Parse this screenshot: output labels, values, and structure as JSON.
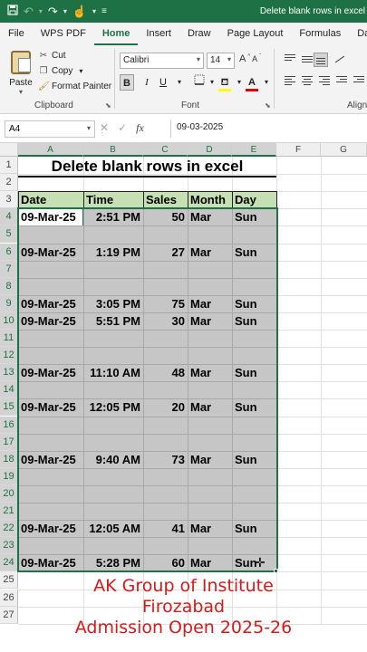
{
  "titlebar": {
    "document_title": "Delete blank rows in excel"
  },
  "ribbon_tabs": [
    "File",
    "WPS PDF",
    "Home",
    "Insert",
    "Draw",
    "Page Layout",
    "Formulas",
    "Da"
  ],
  "active_tab": "Home",
  "clipboard": {
    "paste_label": "Paste",
    "cut_label": "Cut",
    "copy_label": "Copy",
    "format_painter_label": "Format Painter",
    "group_label": "Clipboard"
  },
  "font": {
    "family": "Calibri",
    "size": "14",
    "group_label": "Font",
    "bold_label": "B",
    "italic_label": "I",
    "underline_label": "U",
    "fill_color": "#ffff00",
    "font_color": "#e00000"
  },
  "alignment": {
    "group_label": "Align"
  },
  "formula_bar": {
    "name_box": "A4",
    "formula": "09-03-2025",
    "fx_label": "fx"
  },
  "columns": [
    "A",
    "B",
    "C",
    "D",
    "E",
    "F",
    "G"
  ],
  "sheet": {
    "title": "Delete blank rows in excel",
    "headers": [
      "Date",
      "Time",
      "Sales",
      "Month",
      "Day"
    ],
    "rows": [
      {
        "row": "4",
        "date": "09-Mar-25",
        "time": "2:51 PM",
        "sales": "50",
        "month": "Mar",
        "day": "Sun"
      },
      {
        "row": "5",
        "date": "",
        "time": "",
        "sales": "",
        "month": "",
        "day": ""
      },
      {
        "row": "6",
        "date": "09-Mar-25",
        "time": "1:19 PM",
        "sales": "27",
        "month": "Mar",
        "day": "Sun"
      },
      {
        "row": "7",
        "date": "",
        "time": "",
        "sales": "",
        "month": "",
        "day": ""
      },
      {
        "row": "8",
        "date": "",
        "time": "",
        "sales": "",
        "month": "",
        "day": ""
      },
      {
        "row": "9",
        "date": "09-Mar-25",
        "time": "3:05 PM",
        "sales": "75",
        "month": "Mar",
        "day": "Sun"
      },
      {
        "row": "10",
        "date": "09-Mar-25",
        "time": "5:51 PM",
        "sales": "30",
        "month": "Mar",
        "day": "Sun"
      },
      {
        "row": "11",
        "date": "",
        "time": "",
        "sales": "",
        "month": "",
        "day": ""
      },
      {
        "row": "12",
        "date": "",
        "time": "",
        "sales": "",
        "month": "",
        "day": ""
      },
      {
        "row": "13",
        "date": "09-Mar-25",
        "time": "11:10 AM",
        "sales": "48",
        "month": "Mar",
        "day": "Sun"
      },
      {
        "row": "14",
        "date": "",
        "time": "",
        "sales": "",
        "month": "",
        "day": ""
      },
      {
        "row": "15",
        "date": "09-Mar-25",
        "time": "12:05 PM",
        "sales": "20",
        "month": "Mar",
        "day": "Sun"
      },
      {
        "row": "16",
        "date": "",
        "time": "",
        "sales": "",
        "month": "",
        "day": ""
      },
      {
        "row": "17",
        "date": "",
        "time": "",
        "sales": "",
        "month": "",
        "day": ""
      },
      {
        "row": "18",
        "date": "09-Mar-25",
        "time": "9:40 AM",
        "sales": "73",
        "month": "Mar",
        "day": "Sun"
      },
      {
        "row": "19",
        "date": "",
        "time": "",
        "sales": "",
        "month": "",
        "day": ""
      },
      {
        "row": "20",
        "date": "",
        "time": "",
        "sales": "",
        "month": "",
        "day": ""
      },
      {
        "row": "21",
        "date": "",
        "time": "",
        "sales": "",
        "month": "",
        "day": ""
      },
      {
        "row": "22",
        "date": "09-Mar-25",
        "time": "12:05 AM",
        "sales": "41",
        "month": "Mar",
        "day": "Sun"
      },
      {
        "row": "23",
        "date": "",
        "time": "",
        "sales": "",
        "month": "",
        "day": ""
      },
      {
        "row": "24",
        "date": "09-Mar-25",
        "time": "5:28 PM",
        "sales": "60",
        "month": "Mar",
        "day": "Sun"
      }
    ],
    "extra_rows": [
      "25",
      "26",
      "27"
    ],
    "top_rows": [
      "1",
      "2",
      "3"
    ],
    "header_fill": "#c6e0b4",
    "selection_fill": "#c6c6c6"
  },
  "overlay": {
    "line1": "AK Group of Institute",
    "line2": "Firozabad",
    "line3": "Admission Open 2025-26",
    "color": "#d61a1a"
  }
}
